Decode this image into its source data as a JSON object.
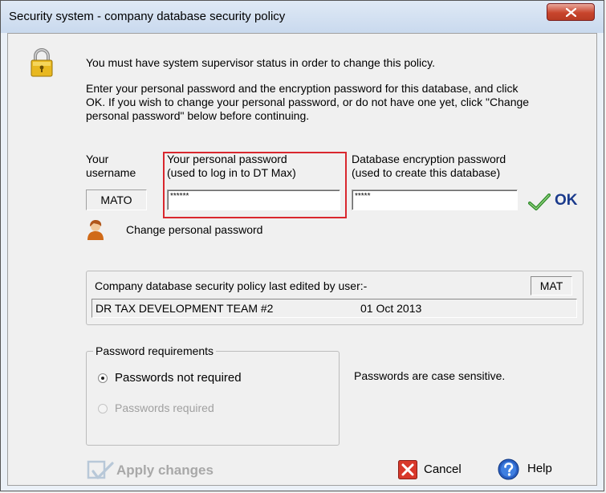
{
  "window": {
    "title": "Security system - company database security policy"
  },
  "intro": {
    "line1": "You must have system supervisor status in order to change this policy.",
    "line2a": "Enter your personal password and the encryption password for this database, and click",
    "line2b": "OK. If you wish to change your personal password, or do not have one yet, click \"Change",
    "line2c": "personal password\" below before continuing."
  },
  "fields": {
    "username_label_1": "Your",
    "username_label_2": "username",
    "username_value": "MATO",
    "personal_label_1": "Your personal password",
    "personal_label_2": "(used to log in to DT Max)",
    "personal_value": "******",
    "db_label_1": "Database encryption password",
    "db_label_2": "(used to create this database)",
    "db_value": "*****"
  },
  "ok_button": {
    "label": "OK"
  },
  "change_password": {
    "label": "Change personal password"
  },
  "last_edited": {
    "label": "Company database security policy last edited by user:-",
    "user_code": "MAT",
    "user_name": "DR TAX DEVELOPMENT TEAM #2",
    "date": "01 Oct 2013"
  },
  "password_requirements": {
    "group_label": "Password requirements",
    "options": [
      {
        "label": "Passwords not required",
        "selected": true,
        "enabled": true
      },
      {
        "label": "Passwords required",
        "selected": false,
        "enabled": false
      }
    ],
    "note": "Passwords are case sensitive."
  },
  "footer": {
    "apply_label": "Apply changes",
    "cancel_label": "Cancel",
    "help_label": "Help"
  },
  "colors": {
    "highlight_border": "#d9272e",
    "ok_text": "#1a3a8c",
    "disabled_text": "#a0a0a0"
  },
  "icons": [
    "padlock-icon",
    "close-x-icon",
    "checkmark-icon",
    "user-icon",
    "cancel-x-icon",
    "help-icon",
    "apply-icon"
  ]
}
